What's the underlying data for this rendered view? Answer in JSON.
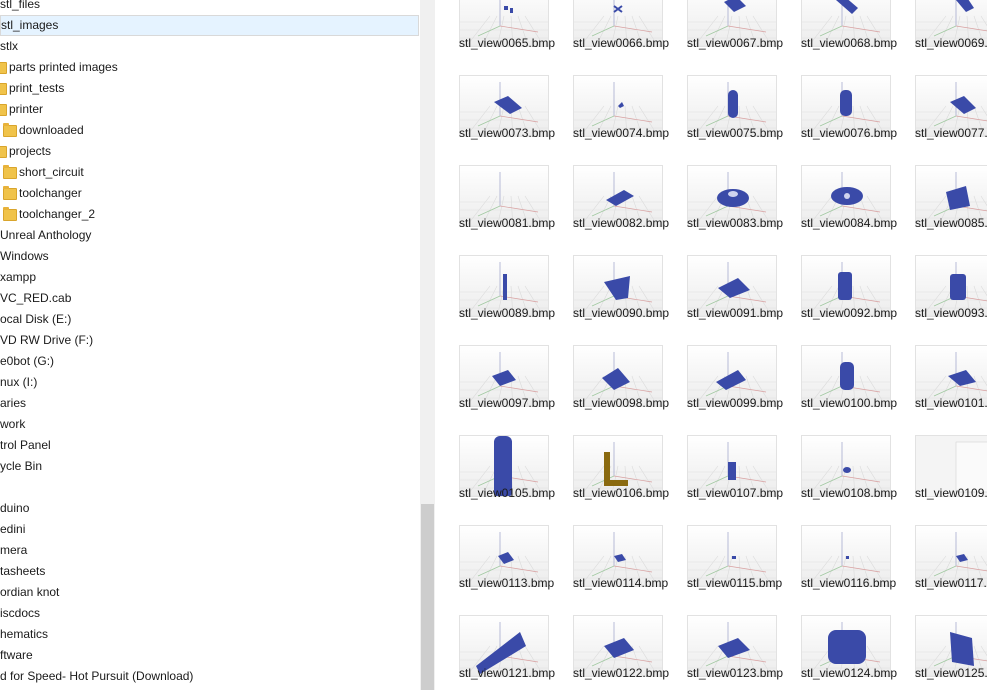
{
  "tree": {
    "items": [
      {
        "label": "stl_files",
        "folder": false,
        "selected": false
      },
      {
        "label": "stl_images",
        "folder": false,
        "selected": true
      },
      {
        "label": "stlx",
        "folder": false,
        "selected": false
      },
      {
        "label": "parts printed images",
        "folder": true,
        "selected": false
      },
      {
        "label": "print_tests",
        "folder": true,
        "selected": false
      },
      {
        "label": "printer",
        "folder": true,
        "selected": false
      },
      {
        "label": "downloaded",
        "folder": true,
        "selected": false
      },
      {
        "label": "projects",
        "folder": true,
        "selected": false
      },
      {
        "label": "short_circuit",
        "folder": true,
        "selected": false
      },
      {
        "label": "toolchanger",
        "folder": true,
        "selected": false
      },
      {
        "label": "toolchanger_2",
        "folder": true,
        "selected": false
      },
      {
        "label": "Unreal Anthology",
        "folder": false,
        "selected": false
      },
      {
        "label": "Windows",
        "folder": false,
        "selected": false
      },
      {
        "label": "xampp",
        "folder": false,
        "selected": false
      },
      {
        "label": "VC_RED.cab",
        "folder": false,
        "selected": false
      },
      {
        "label": "ocal Disk (E:)",
        "folder": false,
        "selected": false
      },
      {
        "label": "VD RW Drive (F:)",
        "folder": false,
        "selected": false
      },
      {
        "label": "e0bot (G:)",
        "folder": false,
        "selected": false
      },
      {
        "label": "nux (I:)",
        "folder": false,
        "selected": false
      },
      {
        "label": "aries",
        "folder": false,
        "selected": false
      },
      {
        "label": "work",
        "folder": false,
        "selected": false
      },
      {
        "label": "trol Panel",
        "folder": false,
        "selected": false
      },
      {
        "label": "ycle Bin",
        "folder": false,
        "selected": false
      },
      {
        "label": "",
        "folder": false,
        "selected": false
      },
      {
        "label": "duino",
        "folder": false,
        "selected": false
      },
      {
        "label": "edini",
        "folder": false,
        "selected": false
      },
      {
        "label": "mera",
        "folder": false,
        "selected": false
      },
      {
        "label": "tasheets",
        "folder": false,
        "selected": false
      },
      {
        "label": "ordian knot",
        "folder": false,
        "selected": false
      },
      {
        "label": "iscdocs",
        "folder": false,
        "selected": false
      },
      {
        "label": "hematics",
        "folder": false,
        "selected": false
      },
      {
        "label": "ftware",
        "folder": false,
        "selected": false
      },
      {
        "label": "d for Speed- Hot Pursuit (Download)",
        "folder": false,
        "selected": false
      }
    ]
  },
  "files": {
    "rows": [
      [
        "stl_view0065.bmp",
        "stl_view0066.bmp",
        "stl_view0067.bmp",
        "stl_view0068.bmp",
        "stl_view0069.b"
      ],
      [
        "stl_view0073.bmp",
        "stl_view0074.bmp",
        "stl_view0075.bmp",
        "stl_view0076.bmp",
        "stl_view0077.b"
      ],
      [
        "stl_view0081.bmp",
        "stl_view0082.bmp",
        "stl_view0083.bmp",
        "stl_view0084.bmp",
        "stl_view0085.b"
      ],
      [
        "stl_view0089.bmp",
        "stl_view0090.bmp",
        "stl_view0091.bmp",
        "stl_view0092.bmp",
        "stl_view0093.b"
      ],
      [
        "stl_view0097.bmp",
        "stl_view0098.bmp",
        "stl_view0099.bmp",
        "stl_view0100.bmp",
        "stl_view0101.b"
      ],
      [
        "stl_view0105.bmp",
        "stl_view0106.bmp",
        "stl_view0107.bmp",
        "stl_view0108.bmp",
        "stl_view0109.b"
      ],
      [
        "stl_view0113.bmp",
        "stl_view0114.bmp",
        "stl_view0115.bmp",
        "stl_view0116.bmp",
        "stl_view0117.b"
      ],
      [
        "stl_view0121.bmp",
        "stl_view0122.bmp",
        "stl_view0123.bmp",
        "stl_view0124.bmp",
        "stl_view0125.b"
      ]
    ]
  },
  "colors": {
    "model": "#3a4aa8",
    "model_gold": "#8a6a10",
    "selection": "#e5f3ff"
  },
  "icons": {
    "folder": "folder-icon",
    "collapse": "chevron-up-icon"
  }
}
